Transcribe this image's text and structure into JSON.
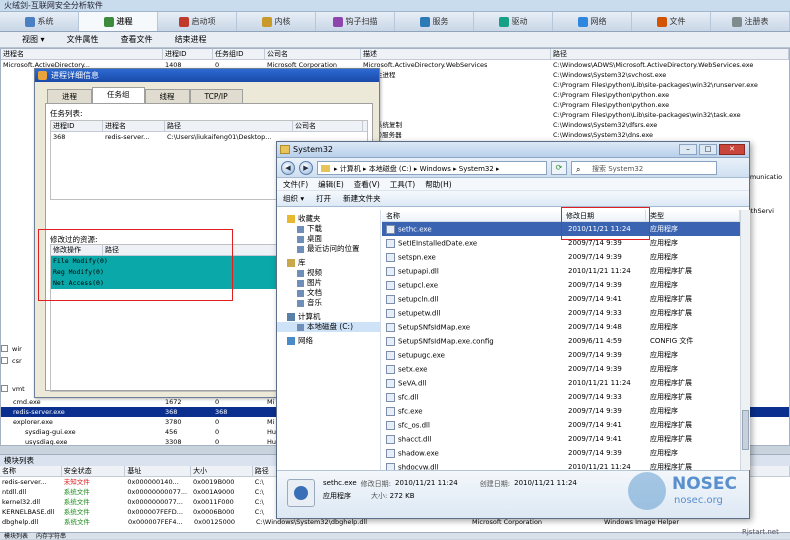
{
  "app": {
    "title": "火绒剑-互联网安全分析软件"
  },
  "topbar": {
    "tabs": [
      {
        "label": "系统",
        "icon": "system-icon",
        "color": "#4a7fc1"
      },
      {
        "label": "进程",
        "icon": "process-icon",
        "color": "#3d8b3d",
        "active": true
      },
      {
        "label": "启动项",
        "icon": "startup-icon",
        "color": "#c0392b"
      },
      {
        "label": "内核",
        "icon": "kernel-icon",
        "color": "#c79a2a"
      },
      {
        "label": "钩子扫描",
        "icon": "hook-icon",
        "color": "#8e44ad"
      },
      {
        "label": "服务",
        "icon": "service-icon",
        "color": "#2c7bb6"
      },
      {
        "label": "驱动",
        "icon": "driver-icon",
        "color": "#16a085"
      },
      {
        "label": "网络",
        "icon": "network-icon",
        "color": "#2e86de"
      },
      {
        "label": "文件",
        "icon": "file-icon",
        "color": "#d35400"
      },
      {
        "label": "注册表",
        "icon": "registry-icon",
        "color": "#7f8c8d"
      }
    ]
  },
  "toolbar": {
    "items": [
      "视图 ▾",
      "文件属性",
      "查看文件",
      "结束进程"
    ]
  },
  "process_table": {
    "headers": [
      "进程名",
      "进程ID",
      "任务组ID",
      "公司名",
      "描述",
      "路径"
    ],
    "rows": [
      {
        "name": "Microsoft.ActiveDirectory...",
        "pid": "1408",
        "tgid": "0",
        "company": "Microsoft Corporation",
        "desc": "Microsoft.ActiveDirectory.WebServices",
        "path": "C:\\Windows\\ADWS\\Microsoft.ActiveDirectory.WebServices.exe"
      },
      {
        "name": "",
        "pid": "",
        "tgid": "",
        "company": "",
        "desc": "服务主进程",
        "path": "C:\\Windows\\System32\\svchost.exe"
      },
      {
        "name": "",
        "pid": "",
        "tgid": "",
        "company": "",
        "desc": "",
        "path": "C:\\Program Files\\python\\Lib\\site-packages\\win32\\runserver.exe"
      },
      {
        "name": "",
        "pid": "",
        "tgid": "",
        "company": "",
        "desc": "",
        "path": "C:\\Program Files\\python\\python.exe"
      },
      {
        "name": "",
        "pid": "",
        "tgid": "",
        "company": "",
        "desc": "",
        "path": "C:\\Program Files\\python\\python.exe"
      },
      {
        "name": "",
        "pid": "",
        "tgid": "",
        "company": "",
        "desc": "",
        "path": "C:\\Program Files\\python\\Lib\\site-packages\\win32\\task.exe"
      },
      {
        "name": "",
        "pid": "",
        "tgid": "",
        "company": "",
        "desc": "文件系统复制",
        "path": "C:\\Windows\\System32\\dfsrs.exe"
      },
      {
        "name": "",
        "pid": "",
        "tgid": "",
        "company": "",
        "desc": "(DNS)服务器",
        "path": "C:\\Windows\\System32\\dns.exe"
      }
    ],
    "extra_right": [
      "Communicatio",
      "\\GAuthServi"
    ],
    "lower_rows": [
      {
        "name": "cmd.exe",
        "pid": "1672",
        "tgid": "0",
        "company": "Mi"
      },
      {
        "name": "redis-server.exe",
        "pid": "368",
        "tgid": "368",
        "company": "",
        "selected": true
      },
      {
        "name": "explorer.exe",
        "pid": "3780",
        "tgid": "0",
        "company": "Mi"
      },
      {
        "name": "sysdiag-gui.exe",
        "pid": "456",
        "tgid": "0",
        "company": "Hu"
      },
      {
        "name": "usysdiag.exe",
        "pid": "3308",
        "tgid": "0",
        "company": "Hu"
      }
    ],
    "tree_labels": [
      "wir",
      "csr",
      "vmt"
    ]
  },
  "modules": {
    "title": "模块列表",
    "headers": [
      "名称",
      "安全状态",
      "基址",
      "大小",
      "路径"
    ],
    "rows": [
      {
        "name": "redis-server...",
        "status": "未知文件",
        "base": "0x000000140...",
        "size": "0x0019B000",
        "path": "C:\\",
        "status_color": "#e02020"
      },
      {
        "name": "ntdll.dll",
        "status": "系统文件",
        "base": "0x00000000077...",
        "size": "0x001A9000",
        "path": "C:\\",
        "status_color": "#1a8a1a"
      },
      {
        "name": "kernel32.dll",
        "status": "系统文件",
        "base": "0x0000000077...",
        "size": "0x0011F000",
        "path": "C:\\",
        "status_color": "#1a8a1a"
      },
      {
        "name": "KERNELBASE.dll",
        "status": "系统文件",
        "base": "0x000007FEFD...",
        "size": "0x0006B000",
        "path": "C:\\",
        "status_color": "#1a8a1a"
      },
      {
        "name": "dbghelp.dll",
        "status": "系统文件",
        "base": "0x000007FEF4...",
        "size": "0x00125000",
        "path": "C:\\Windows\\System32\\dbghelp.dll",
        "company": "Microsoft Corporation",
        "desc": "Windows Image Helper",
        "status_color": "#1a8a1a"
      }
    ]
  },
  "status_tabs": [
    "模块列表",
    "内存字符串"
  ],
  "dialog": {
    "title": "进程详细信息",
    "tabs": [
      "进程",
      "任务组",
      "线程",
      "TCP/IP"
    ],
    "active_tab": "任务组",
    "task_label": "任务列表:",
    "task_headers": [
      "进程ID",
      "进程名",
      "路径",
      "公司名"
    ],
    "task_row": {
      "pid": "368",
      "name": "redis-server...",
      "path": "C:\\Users\\liukaifeng01\\Desktop...",
      "company": ""
    },
    "modified_label": "修改过的资源:",
    "mod_headers": [
      "修改操作",
      "路径"
    ],
    "mod_rows": [
      "File Modify(0)",
      "Reg Modify(0)",
      "Net Access(0)"
    ],
    "highlight_color": "#0aa8a8"
  },
  "explorer": {
    "title": "System32",
    "address": "▸ 计算机 ▸ 本地磁盘 (C:) ▸ Windows ▸ System32 ▸",
    "search_placeholder": "搜索 System32",
    "menu": [
      "文件(F)",
      "编辑(E)",
      "查看(V)",
      "工具(T)",
      "帮助(H)"
    ],
    "commands": [
      "组织 ▾",
      "打开",
      "新建文件夹"
    ],
    "nav": {
      "favorites": "收藏夹",
      "fav_items": [
        "下载",
        "桌面",
        "最近访问的位置"
      ],
      "libraries": "库",
      "lib_items": [
        "视频",
        "图片",
        "文档",
        "音乐"
      ],
      "computer": "计算机",
      "computer_items": [
        "本地磁盘 (C:)"
      ],
      "network": "网络"
    },
    "columns": [
      "名称",
      "修改日期",
      "类型"
    ],
    "files": [
      {
        "name": "sethc.exe",
        "date": "2010/11/21 11:24",
        "type": "应用程序",
        "selected": true
      },
      {
        "name": "SetIEInstalledDate.exe",
        "date": "2009/7/14 9:39",
        "type": "应用程序"
      },
      {
        "name": "setspn.exe",
        "date": "2009/7/14 9:39",
        "type": "应用程序"
      },
      {
        "name": "setupapi.dll",
        "date": "2010/11/21 11:24",
        "type": "应用程序扩展"
      },
      {
        "name": "setupcl.exe",
        "date": "2009/7/14 9:39",
        "type": "应用程序"
      },
      {
        "name": "setupcln.dll",
        "date": "2009/7/14 9:41",
        "type": "应用程序扩展"
      },
      {
        "name": "setupetw.dll",
        "date": "2009/7/14 9:33",
        "type": "应用程序扩展"
      },
      {
        "name": "SetupSNfsIdMap.exe",
        "date": "2009/7/14 9:48",
        "type": "应用程序"
      },
      {
        "name": "SetupSNfsIdMap.exe.config",
        "date": "2009/6/11 4:59",
        "type": "CONFIG 文件"
      },
      {
        "name": "setupugc.exe",
        "date": "2009/7/14 9:39",
        "type": "应用程序"
      },
      {
        "name": "setx.exe",
        "date": "2009/7/14 9:39",
        "type": "应用程序"
      },
      {
        "name": "SeVA.dll",
        "date": "2010/11/21 11:24",
        "type": "应用程序扩展"
      },
      {
        "name": "sfc.dll",
        "date": "2009/7/14 9:33",
        "type": "应用程序扩展"
      },
      {
        "name": "sfc.exe",
        "date": "2009/7/14 9:39",
        "type": "应用程序"
      },
      {
        "name": "sfc_os.dll",
        "date": "2009/7/14 9:41",
        "type": "应用程序扩展"
      },
      {
        "name": "shacct.dll",
        "date": "2009/7/14 9:41",
        "type": "应用程序扩展"
      },
      {
        "name": "shadow.exe",
        "date": "2009/7/14 9:39",
        "type": "应用程序"
      },
      {
        "name": "shdocvw.dll",
        "date": "2010/11/21 11:24",
        "type": "应用程序扩展"
      }
    ],
    "details": {
      "name": "sethc.exe",
      "modified_label": "修改日期:",
      "modified": "2010/11/21 11:24",
      "created_label": "创建日期:",
      "created": "2010/11/21 11:24",
      "type": "应用程序",
      "size_label": "大小:",
      "size": "272 KB"
    }
  },
  "watermark": {
    "brand": "NOSEC",
    "url": "nosec.org",
    "corner": "Rjstart.net"
  }
}
